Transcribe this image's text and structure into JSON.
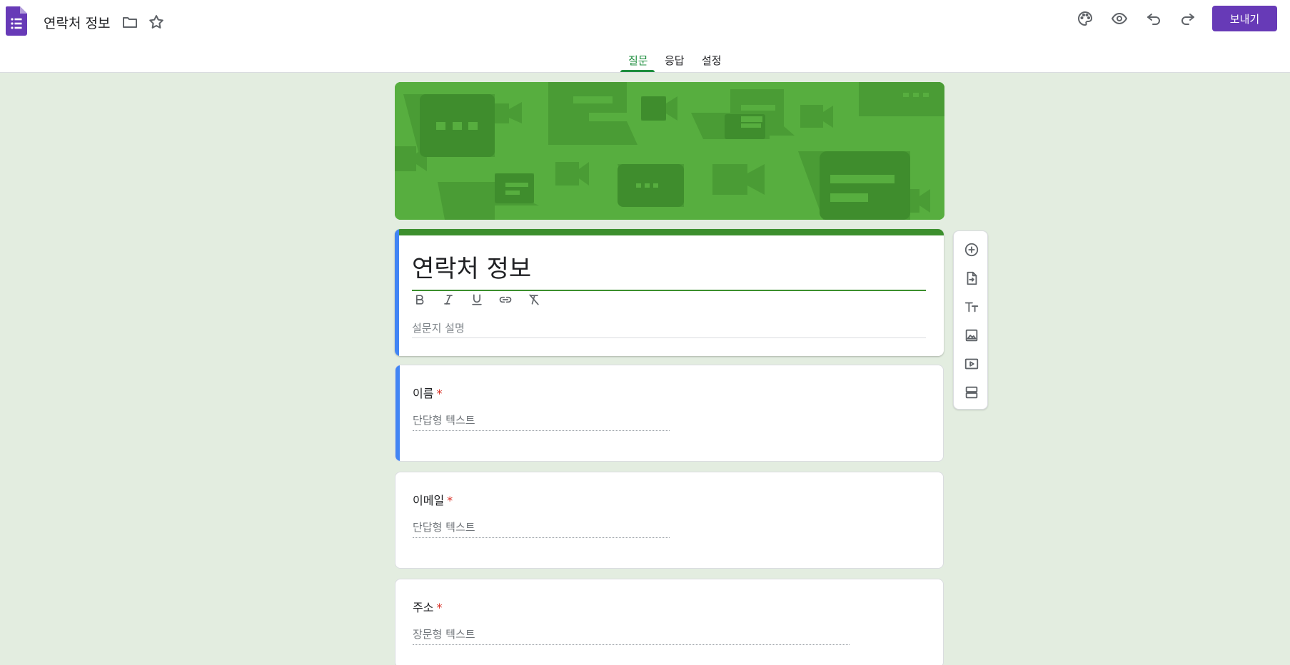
{
  "header": {
    "doc_title": "연락처 정보",
    "send_label": "보내기",
    "accent_color": "#673ab7"
  },
  "tabs": [
    {
      "label": "질문",
      "active": true
    },
    {
      "label": "응답",
      "active": false
    },
    {
      "label": "설정",
      "active": false
    }
  ],
  "form": {
    "title": "연락처 정보",
    "description_placeholder": "설문지 설명",
    "theme_color": "#3c8f2d"
  },
  "questions": [
    {
      "label": "이름",
      "required_mark": "*",
      "answer_placeholder": "단답형 텍스트"
    },
    {
      "label": "이메일",
      "required_mark": "*",
      "answer_placeholder": "단답형 텍스트"
    },
    {
      "label": "주소",
      "required_mark": "*",
      "answer_placeholder": "장문형 텍스트"
    }
  ],
  "icons": {
    "header": [
      "folder-icon",
      "star-icon",
      "palette-icon",
      "eye-icon",
      "undo-icon",
      "redo-icon"
    ],
    "format": [
      "bold-icon",
      "italic-icon",
      "underline-icon",
      "link-icon",
      "clear-format-icon"
    ],
    "side_toolbar": [
      "add-question-icon",
      "import-questions-icon",
      "add-title-icon",
      "add-image-icon",
      "add-video-icon",
      "add-section-icon"
    ]
  }
}
